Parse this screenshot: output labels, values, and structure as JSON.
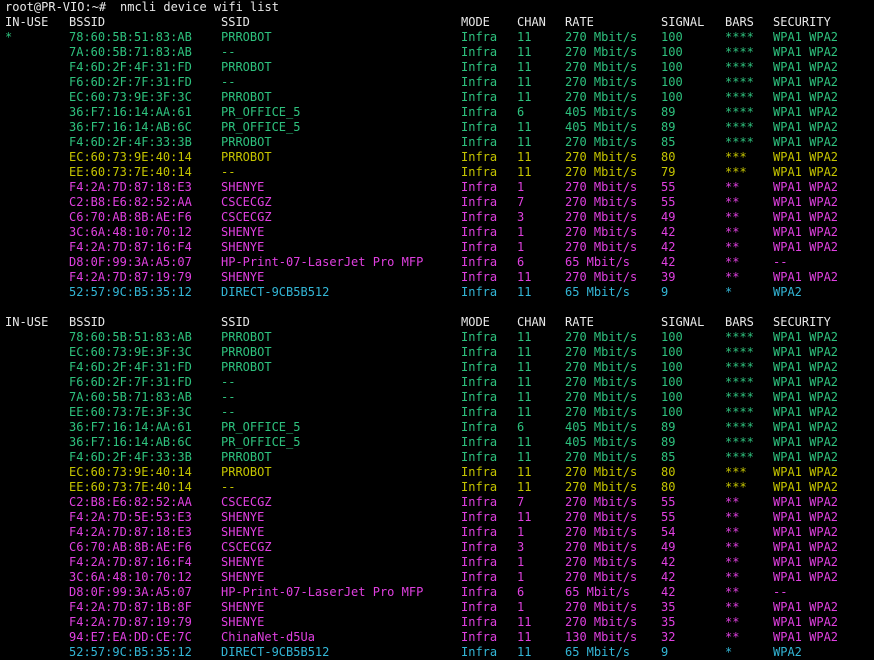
{
  "terminal": {
    "prompt": "root@PR-VIO:~#",
    "command": "nmcli device wifi list",
    "colors": {
      "green": "#2ec27e",
      "yellow": "#c5c500",
      "magenta": "#e040e0",
      "cyan": "#33b6d6",
      "text": "#e8e8e8"
    },
    "columns": [
      "IN-USE",
      "BSSID",
      "SSID",
      "MODE",
      "CHAN",
      "RATE",
      "SIGNAL",
      "BARS",
      "SECURITY"
    ],
    "blocks": [
      {
        "rows": [
          {
            "inuse": "*",
            "bssid": "78:60:5B:51:83:AB",
            "ssid": "PRROBOT",
            "mode": "Infra",
            "chan": "11",
            "rate": "270 Mbit/s",
            "signal": "100",
            "bars": "****",
            "security": "WPA1 WPA2",
            "color": "green"
          },
          {
            "inuse": "",
            "bssid": "7A:60:5B:71:83:AB",
            "ssid": "--",
            "mode": "Infra",
            "chan": "11",
            "rate": "270 Mbit/s",
            "signal": "100",
            "bars": "****",
            "security": "WPA1 WPA2",
            "color": "green"
          },
          {
            "inuse": "",
            "bssid": "F4:6D:2F:4F:31:FD",
            "ssid": "PRROBOT",
            "mode": "Infra",
            "chan": "11",
            "rate": "270 Mbit/s",
            "signal": "100",
            "bars": "****",
            "security": "WPA1 WPA2",
            "color": "green"
          },
          {
            "inuse": "",
            "bssid": "F6:6D:2F:7F:31:FD",
            "ssid": "--",
            "mode": "Infra",
            "chan": "11",
            "rate": "270 Mbit/s",
            "signal": "100",
            "bars": "****",
            "security": "WPA1 WPA2",
            "color": "green"
          },
          {
            "inuse": "",
            "bssid": "EC:60:73:9E:3F:3C",
            "ssid": "PRROBOT",
            "mode": "Infra",
            "chan": "11",
            "rate": "270 Mbit/s",
            "signal": "100",
            "bars": "****",
            "security": "WPA1 WPA2",
            "color": "green"
          },
          {
            "inuse": "",
            "bssid": "36:F7:16:14:AA:61",
            "ssid": "PR_OFFICE_5",
            "mode": "Infra",
            "chan": "6",
            "rate": "405 Mbit/s",
            "signal": "89",
            "bars": "****",
            "security": "WPA1 WPA2",
            "color": "green"
          },
          {
            "inuse": "",
            "bssid": "36:F7:16:14:AB:6C",
            "ssid": "PR_OFFICE_5",
            "mode": "Infra",
            "chan": "11",
            "rate": "405 Mbit/s",
            "signal": "89",
            "bars": "****",
            "security": "WPA1 WPA2",
            "color": "green"
          },
          {
            "inuse": "",
            "bssid": "F4:6D:2F:4F:33:3B",
            "ssid": "PRROBOT",
            "mode": "Infra",
            "chan": "11",
            "rate": "270 Mbit/s",
            "signal": "85",
            "bars": "****",
            "security": "WPA1 WPA2",
            "color": "green"
          },
          {
            "inuse": "",
            "bssid": "EC:60:73:9E:40:14",
            "ssid": "PRROBOT",
            "mode": "Infra",
            "chan": "11",
            "rate": "270 Mbit/s",
            "signal": "80",
            "bars": "***",
            "security": "WPA1 WPA2",
            "color": "yellow"
          },
          {
            "inuse": "",
            "bssid": "EE:60:73:7E:40:14",
            "ssid": "--",
            "mode": "Infra",
            "chan": "11",
            "rate": "270 Mbit/s",
            "signal": "79",
            "bars": "***",
            "security": "WPA1 WPA2",
            "color": "yellow"
          },
          {
            "inuse": "",
            "bssid": "F4:2A:7D:87:18:E3",
            "ssid": "SHENYE",
            "mode": "Infra",
            "chan": "1",
            "rate": "270 Mbit/s",
            "signal": "55",
            "bars": "**",
            "security": "WPA1 WPA2",
            "color": "magenta"
          },
          {
            "inuse": "",
            "bssid": "C2:B8:E6:82:52:AA",
            "ssid": "CSCECGZ",
            "mode": "Infra",
            "chan": "7",
            "rate": "270 Mbit/s",
            "signal": "55",
            "bars": "**",
            "security": "WPA1 WPA2",
            "color": "magenta"
          },
          {
            "inuse": "",
            "bssid": "C6:70:AB:8B:AE:F6",
            "ssid": "CSCECGZ",
            "mode": "Infra",
            "chan": "3",
            "rate": "270 Mbit/s",
            "signal": "49",
            "bars": "**",
            "security": "WPA1 WPA2",
            "color": "magenta"
          },
          {
            "inuse": "",
            "bssid": "3C:6A:48:10:70:12",
            "ssid": "SHENYE",
            "mode": "Infra",
            "chan": "1",
            "rate": "270 Mbit/s",
            "signal": "42",
            "bars": "**",
            "security": "WPA1 WPA2",
            "color": "magenta"
          },
          {
            "inuse": "",
            "bssid": "F4:2A:7D:87:16:F4",
            "ssid": "SHENYE",
            "mode": "Infra",
            "chan": "1",
            "rate": "270 Mbit/s",
            "signal": "42",
            "bars": "**",
            "security": "WPA1 WPA2",
            "color": "magenta"
          },
          {
            "inuse": "",
            "bssid": "D8:0F:99:3A:A5:07",
            "ssid": "HP-Print-07-LaserJet Pro MFP",
            "mode": "Infra",
            "chan": "6",
            "rate": "65 Mbit/s",
            "signal": "42",
            "bars": "**",
            "security": "--",
            "color": "magenta"
          },
          {
            "inuse": "",
            "bssid": "F4:2A:7D:87:19:79",
            "ssid": "SHENYE",
            "mode": "Infra",
            "chan": "11",
            "rate": "270 Mbit/s",
            "signal": "39",
            "bars": "**",
            "security": "WPA1 WPA2",
            "color": "magenta"
          },
          {
            "inuse": "",
            "bssid": "52:57:9C:B5:35:12",
            "ssid": "DIRECT-9CB5B512",
            "mode": "Infra",
            "chan": "11",
            "rate": "65 Mbit/s",
            "signal": "9",
            "bars": "*",
            "security": "WPA2",
            "color": "cyan"
          }
        ]
      },
      {
        "rows": [
          {
            "inuse": "",
            "bssid": "78:60:5B:51:83:AB",
            "ssid": "PRROBOT",
            "mode": "Infra",
            "chan": "11",
            "rate": "270 Mbit/s",
            "signal": "100",
            "bars": "****",
            "security": "WPA1 WPA2",
            "color": "green"
          },
          {
            "inuse": "",
            "bssid": "EC:60:73:9E:3F:3C",
            "ssid": "PRROBOT",
            "mode": "Infra",
            "chan": "11",
            "rate": "270 Mbit/s",
            "signal": "100",
            "bars": "****",
            "security": "WPA1 WPA2",
            "color": "green"
          },
          {
            "inuse": "",
            "bssid": "F4:6D:2F:4F:31:FD",
            "ssid": "PRROBOT",
            "mode": "Infra",
            "chan": "11",
            "rate": "270 Mbit/s",
            "signal": "100",
            "bars": "****",
            "security": "WPA1 WPA2",
            "color": "green"
          },
          {
            "inuse": "",
            "bssid": "F6:6D:2F:7F:31:FD",
            "ssid": "--",
            "mode": "Infra",
            "chan": "11",
            "rate": "270 Mbit/s",
            "signal": "100",
            "bars": "****",
            "security": "WPA1 WPA2",
            "color": "green"
          },
          {
            "inuse": "",
            "bssid": "7A:60:5B:71:83:AB",
            "ssid": "--",
            "mode": "Infra",
            "chan": "11",
            "rate": "270 Mbit/s",
            "signal": "100",
            "bars": "****",
            "security": "WPA1 WPA2",
            "color": "green"
          },
          {
            "inuse": "",
            "bssid": "EE:60:73:7E:3F:3C",
            "ssid": "--",
            "mode": "Infra",
            "chan": "11",
            "rate": "270 Mbit/s",
            "signal": "100",
            "bars": "****",
            "security": "WPA1 WPA2",
            "color": "green"
          },
          {
            "inuse": "",
            "bssid": "36:F7:16:14:AA:61",
            "ssid": "PR_OFFICE_5",
            "mode": "Infra",
            "chan": "6",
            "rate": "405 Mbit/s",
            "signal": "89",
            "bars": "****",
            "security": "WPA1 WPA2",
            "color": "green"
          },
          {
            "inuse": "",
            "bssid": "36:F7:16:14:AB:6C",
            "ssid": "PR_OFFICE_5",
            "mode": "Infra",
            "chan": "11",
            "rate": "405 Mbit/s",
            "signal": "89",
            "bars": "****",
            "security": "WPA1 WPA2",
            "color": "green"
          },
          {
            "inuse": "",
            "bssid": "F4:6D:2F:4F:33:3B",
            "ssid": "PRROBOT",
            "mode": "Infra",
            "chan": "11",
            "rate": "270 Mbit/s",
            "signal": "85",
            "bars": "****",
            "security": "WPA1 WPA2",
            "color": "green"
          },
          {
            "inuse": "",
            "bssid": "EC:60:73:9E:40:14",
            "ssid": "PRROBOT",
            "mode": "Infra",
            "chan": "11",
            "rate": "270 Mbit/s",
            "signal": "80",
            "bars": "***",
            "security": "WPA1 WPA2",
            "color": "yellow"
          },
          {
            "inuse": "",
            "bssid": "EE:60:73:7E:40:14",
            "ssid": "--",
            "mode": "Infra",
            "chan": "11",
            "rate": "270 Mbit/s",
            "signal": "80",
            "bars": "***",
            "security": "WPA1 WPA2",
            "color": "yellow"
          },
          {
            "inuse": "",
            "bssid": "C2:B8:E6:82:52:AA",
            "ssid": "CSCECGZ",
            "mode": "Infra",
            "chan": "7",
            "rate": "270 Mbit/s",
            "signal": "55",
            "bars": "**",
            "security": "WPA1 WPA2",
            "color": "magenta"
          },
          {
            "inuse": "",
            "bssid": "F4:2A:7D:5E:53:E3",
            "ssid": "SHENYE",
            "mode": "Infra",
            "chan": "11",
            "rate": "270 Mbit/s",
            "signal": "55",
            "bars": "**",
            "security": "WPA1 WPA2",
            "color": "magenta"
          },
          {
            "inuse": "",
            "bssid": "F4:2A:7D:87:18:E3",
            "ssid": "SHENYE",
            "mode": "Infra",
            "chan": "1",
            "rate": "270 Mbit/s",
            "signal": "54",
            "bars": "**",
            "security": "WPA1 WPA2",
            "color": "magenta"
          },
          {
            "inuse": "",
            "bssid": "C6:70:AB:8B:AE:F6",
            "ssid": "CSCECGZ",
            "mode": "Infra",
            "chan": "3",
            "rate": "270 Mbit/s",
            "signal": "49",
            "bars": "**",
            "security": "WPA1 WPA2",
            "color": "magenta"
          },
          {
            "inuse": "",
            "bssid": "F4:2A:7D:87:16:F4",
            "ssid": "SHENYE",
            "mode": "Infra",
            "chan": "1",
            "rate": "270 Mbit/s",
            "signal": "42",
            "bars": "**",
            "security": "WPA1 WPA2",
            "color": "magenta"
          },
          {
            "inuse": "",
            "bssid": "3C:6A:48:10:70:12",
            "ssid": "SHENYE",
            "mode": "Infra",
            "chan": "1",
            "rate": "270 Mbit/s",
            "signal": "42",
            "bars": "**",
            "security": "WPA1 WPA2",
            "color": "magenta"
          },
          {
            "inuse": "",
            "bssid": "D8:0F:99:3A:A5:07",
            "ssid": "HP-Print-07-LaserJet Pro MFP",
            "mode": "Infra",
            "chan": "6",
            "rate": "65 Mbit/s",
            "signal": "42",
            "bars": "**",
            "security": "--",
            "color": "magenta"
          },
          {
            "inuse": "",
            "bssid": "F4:2A:7D:87:1B:8F",
            "ssid": "SHENYE",
            "mode": "Infra",
            "chan": "1",
            "rate": "270 Mbit/s",
            "signal": "35",
            "bars": "**",
            "security": "WPA1 WPA2",
            "color": "magenta"
          },
          {
            "inuse": "",
            "bssid": "F4:2A:7D:87:19:79",
            "ssid": "SHENYE",
            "mode": "Infra",
            "chan": "11",
            "rate": "270 Mbit/s",
            "signal": "35",
            "bars": "**",
            "security": "WPA1 WPA2",
            "color": "magenta"
          },
          {
            "inuse": "",
            "bssid": "94:E7:EA:DD:CE:7C",
            "ssid": "ChinaNet-d5Ua",
            "mode": "Infra",
            "chan": "11",
            "rate": "130 Mbit/s",
            "signal": "32",
            "bars": "**",
            "security": "WPA1 WPA2",
            "color": "magenta"
          },
          {
            "inuse": "",
            "bssid": "52:57:9C:B5:35:12",
            "ssid": "DIRECT-9CB5B512",
            "mode": "Infra",
            "chan": "11",
            "rate": "65 Mbit/s",
            "signal": "9",
            "bars": "*",
            "security": "WPA2",
            "color": "cyan"
          }
        ]
      }
    ]
  }
}
